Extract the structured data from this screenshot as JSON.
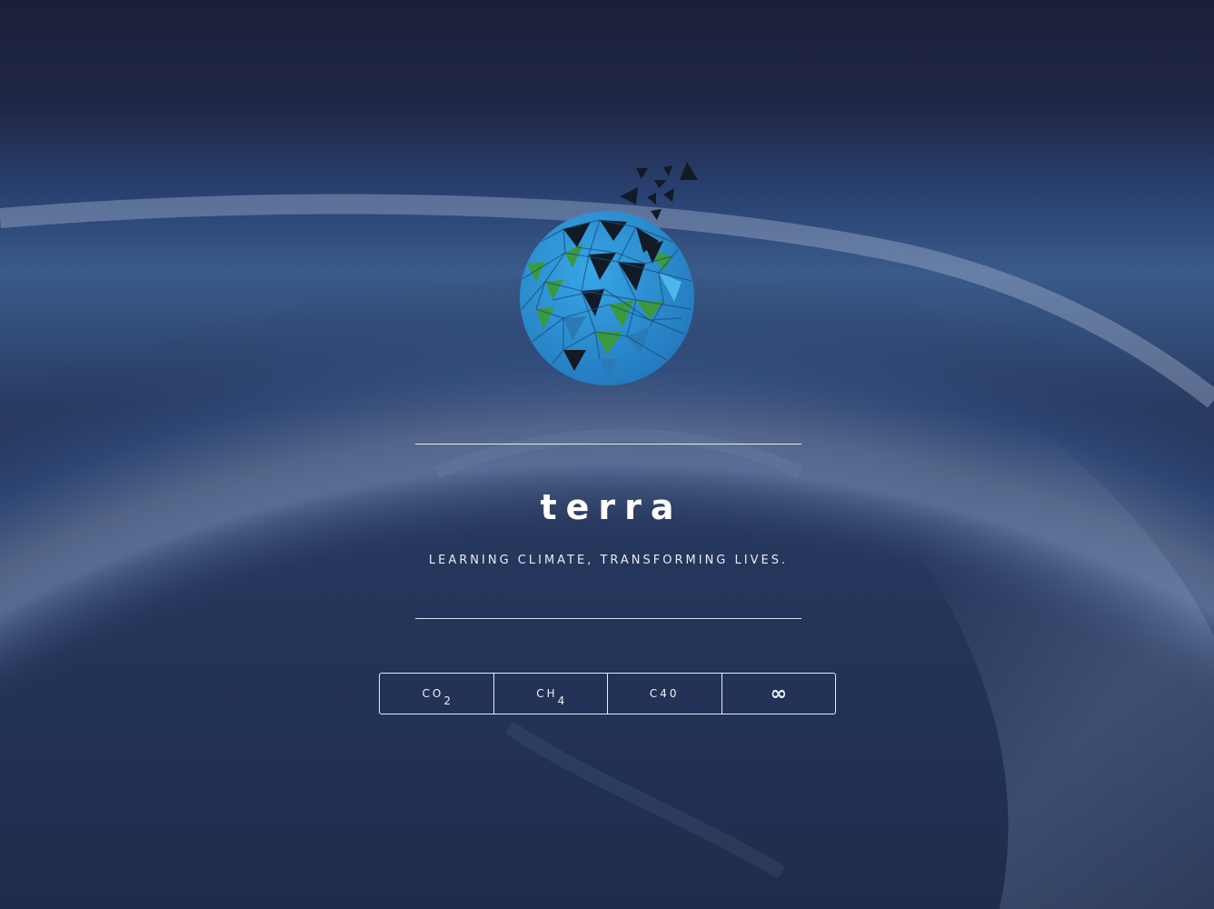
{
  "brand": {
    "title": "terra",
    "tagline": "LEARNING CLIMATE, TRANSFORMING LIVES."
  },
  "buttons": [
    {
      "main": "CO",
      "sub": "2"
    },
    {
      "main": "CH",
      "sub": "4"
    },
    {
      "main": "C40",
      "sub": ""
    },
    {
      "symbol": "∞"
    }
  ],
  "colors": {
    "background_top": "#1b2138",
    "background_bottom": "#20305a",
    "accent_blue": "#2f8fd1",
    "accent_green": "#3a9a3e",
    "accent_dark": "#121a26"
  },
  "icons": {
    "logo": "geodesic-globe-icon"
  }
}
